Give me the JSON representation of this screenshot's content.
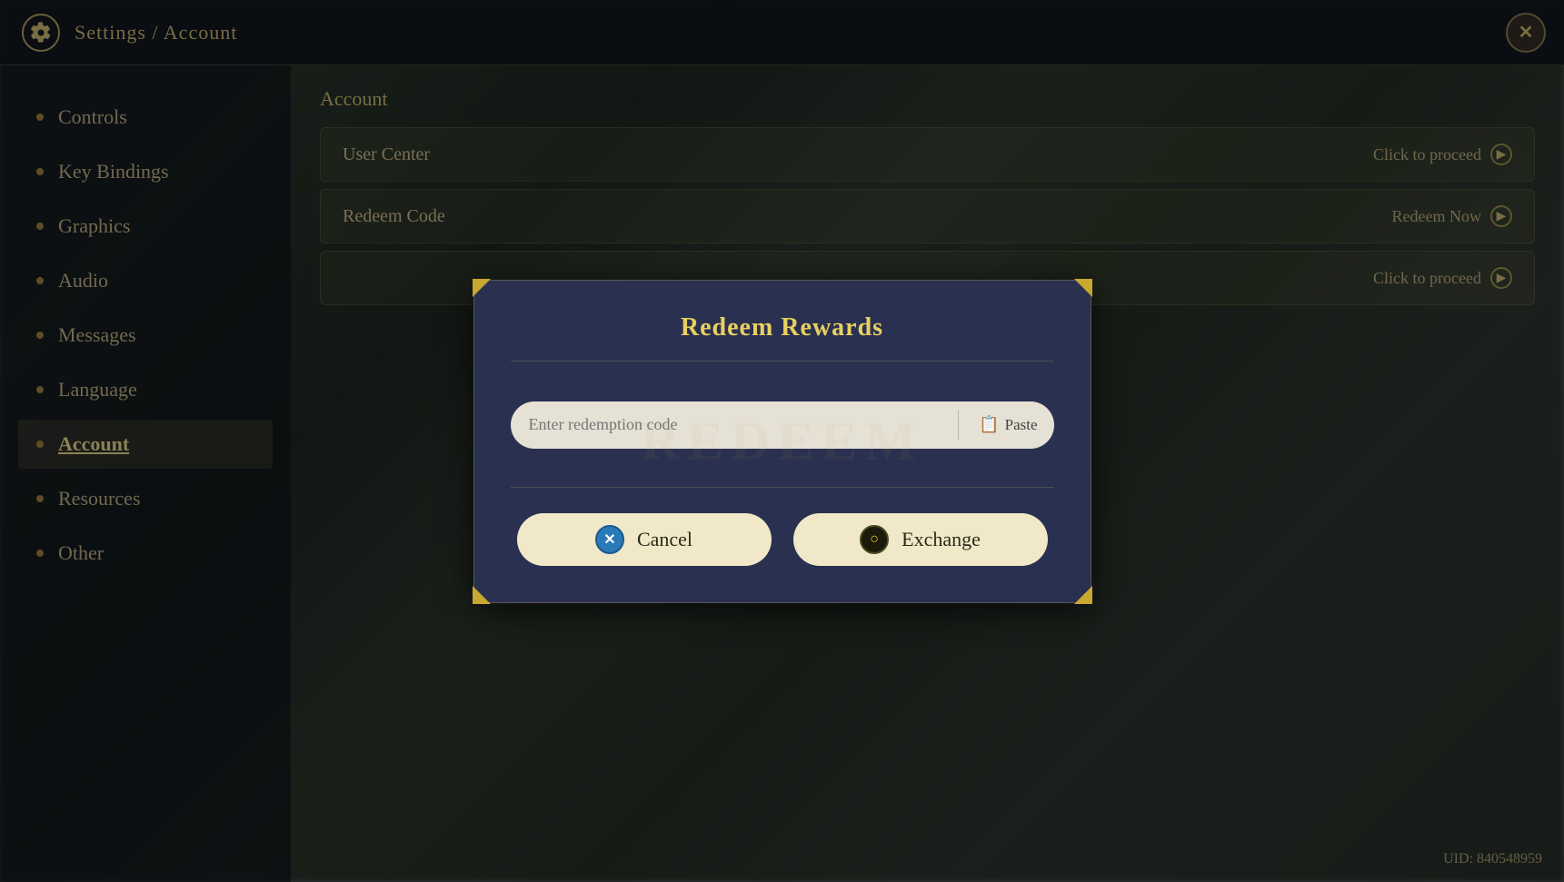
{
  "app": {
    "title": "Settings / Account",
    "close_label": "✕",
    "uid": "UID: 840548959"
  },
  "sidebar": {
    "items": [
      {
        "id": "controls",
        "label": "Controls",
        "active": false
      },
      {
        "id": "key-bindings",
        "label": "Key Bindings",
        "active": false
      },
      {
        "id": "graphics",
        "label": "Graphics",
        "active": false
      },
      {
        "id": "audio",
        "label": "Audio",
        "active": false
      },
      {
        "id": "messages",
        "label": "Messages",
        "active": false
      },
      {
        "id": "language",
        "label": "Language",
        "active": false
      },
      {
        "id": "account",
        "label": "Account",
        "active": true
      },
      {
        "id": "resources",
        "label": "Resources",
        "active": false
      },
      {
        "id": "other",
        "label": "Other",
        "active": false
      }
    ]
  },
  "main": {
    "section_title": "Account",
    "rows": [
      {
        "id": "user-center",
        "label": "User Center",
        "action": "Click to proceed"
      },
      {
        "id": "redeem-code",
        "label": "Redeem Code",
        "action": "Redeem Now"
      },
      {
        "id": "third-row",
        "label": "",
        "action": "Click to proceed"
      }
    ]
  },
  "modal": {
    "title": "Redeem Rewards",
    "watermark": "REDEEM",
    "input": {
      "placeholder": "Enter redemption code",
      "value": ""
    },
    "paste_label": "Paste",
    "buttons": {
      "cancel": "Cancel",
      "exchange": "Exchange"
    }
  }
}
